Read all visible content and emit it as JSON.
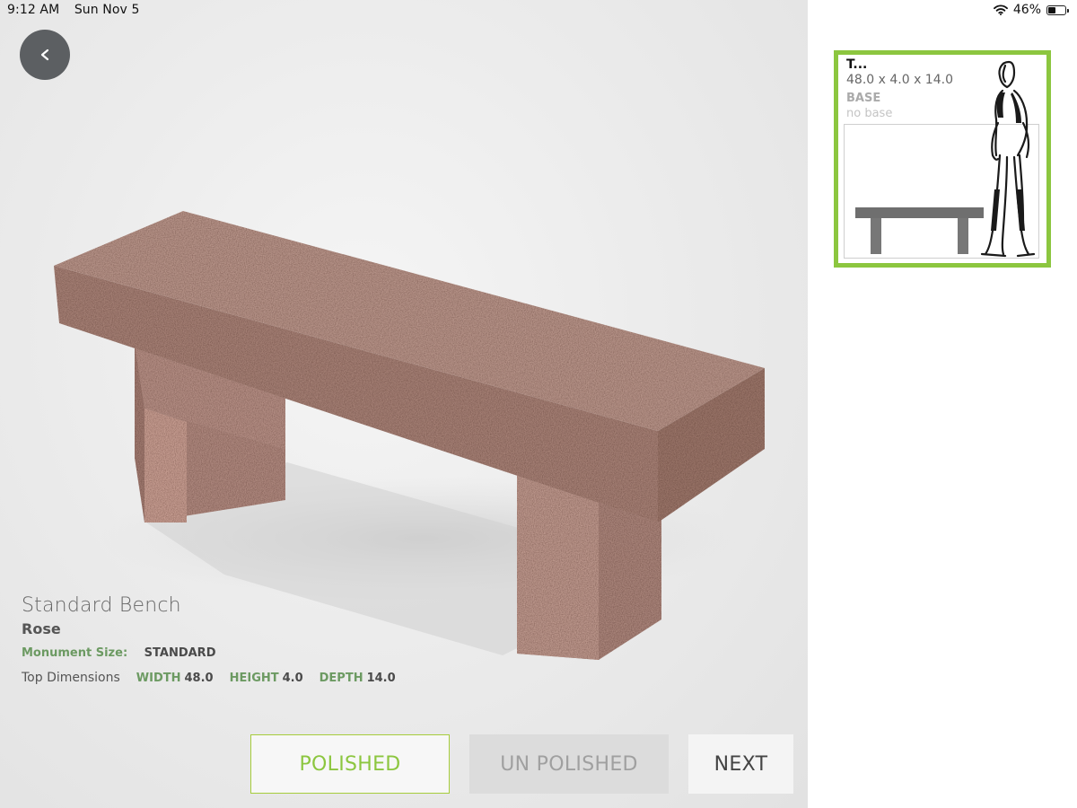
{
  "status_bar": {
    "time": "9:12 AM",
    "date": "Sun Nov 5",
    "battery": "46%",
    "battery_level": 0.46
  },
  "back_button": {
    "icon": "chevron-left-icon"
  },
  "product": {
    "name": "Standard Bench",
    "color": "Rose",
    "monument_size_label": "Monument Size:",
    "monument_size_value": "STANDARD",
    "top_dimensions_label": "Top Dimensions",
    "width_label": "WIDTH",
    "width_value": "48.0",
    "height_label": "HEIGHT",
    "height_value": "4.0",
    "depth_label": "DEPTH",
    "depth_value": "14.0"
  },
  "finish_options": {
    "polished": "POLISHED",
    "unpolished": "UN POLISHED",
    "selected": "POLISHED"
  },
  "next_button": {
    "label": "NEXT"
  },
  "preview": {
    "title": "T...",
    "dimensions": "48.0 x 4.0 x 14.0",
    "base_label": "BASE",
    "base_value": "no base"
  },
  "colors": {
    "accent_green": "#8cc63f",
    "label_green": "#6c9a62",
    "granite_rose": "#a88378"
  }
}
